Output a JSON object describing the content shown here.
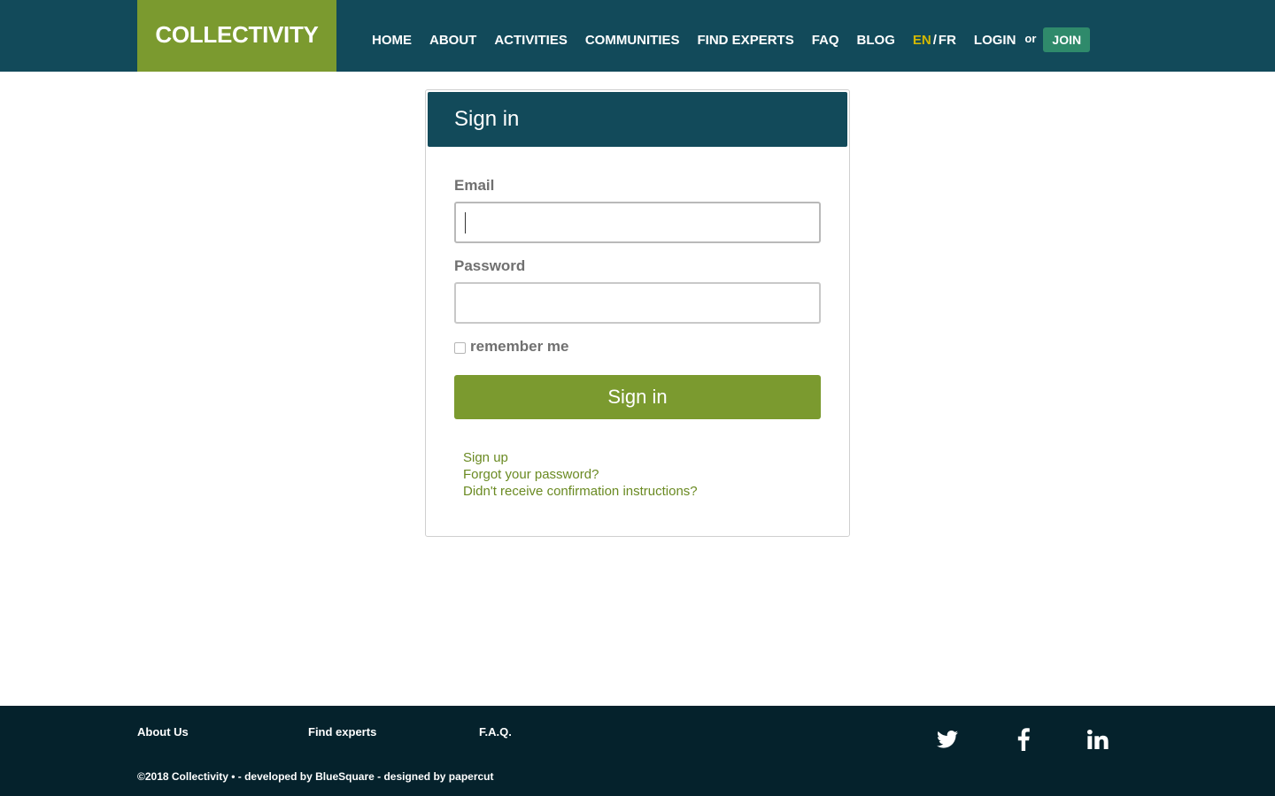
{
  "header": {
    "logo": "COLLECTIVITY",
    "nav": [
      "HOME",
      "ABOUT",
      "ACTIVITIES",
      "COMMUNITIES",
      "FIND EXPERTS",
      "FAQ",
      "BLOG"
    ],
    "lang_en": "EN",
    "lang_sep": "/",
    "lang_fr": "FR",
    "login": "LOGIN",
    "or": "or",
    "join": "JOIN"
  },
  "signin": {
    "title": "Sign in",
    "email_label": "Email",
    "email_value": "",
    "password_label": "Password",
    "password_value": "",
    "remember_label": "remember me",
    "remember_checked": false,
    "submit": "Sign in",
    "links": [
      "Sign up",
      "Forgot your password?",
      "Didn't receive confirmation instructions?"
    ]
  },
  "footer": {
    "links": [
      "About Us",
      "Find experts",
      "F.A.Q."
    ],
    "copyright": "©2018 Collectivity • - developed by BlueSquare - designed by papercut",
    "social": [
      "twitter-icon",
      "facebook-icon",
      "linkedin-icon"
    ]
  },
  "colors": {
    "header_bg": "#124a5a",
    "logo_bg": "#7b9a2f",
    "join_bg": "#2f8a6b",
    "accent_green": "#7b9a2f",
    "link_green": "#6a8a22",
    "lang_active": "#d4b800",
    "footer_bg": "#05222c"
  }
}
